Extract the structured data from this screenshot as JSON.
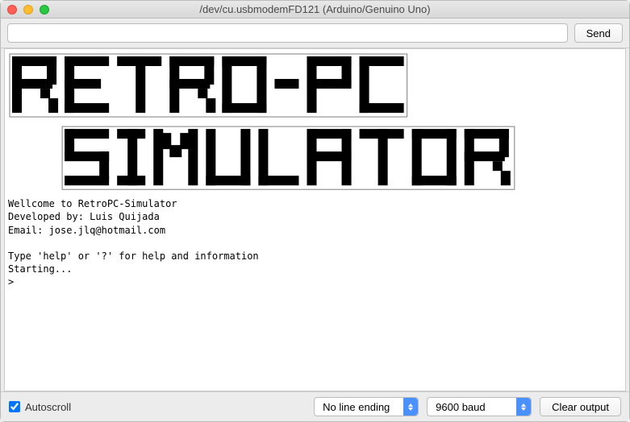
{
  "window": {
    "title": "/dev/cu.usbmodemFD121 (Arduino/Genuino Uno)"
  },
  "toolbar": {
    "input_value": "",
    "send_label": "Send"
  },
  "console": {
    "ascii_title_alt": "RETRO-PC SIMULATOR",
    "text_lines": "Wellcome to RetroPC-Simulator\nDeveloped by: Luis Quijada\nEmail: jose.jlq@hotmail.com\n\nType 'help' or '?' for help and information\nStarting...\n>"
  },
  "bottombar": {
    "autoscroll_label": "Autoscroll",
    "autoscroll_checked": true,
    "line_ending": "No line ending",
    "baud": "9600 baud",
    "clear_label": "Clear output"
  }
}
